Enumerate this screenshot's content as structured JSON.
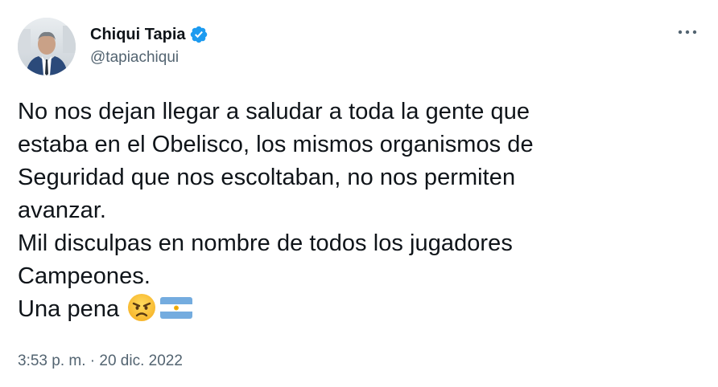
{
  "author": {
    "display_name": "Chiqui Tapia",
    "handle": "@tapiachiqui",
    "verified": true,
    "verified_color": "#1d9bf0"
  },
  "tweet": {
    "lines": [
      "No nos dejan llegar a saludar a toda la gente que",
      "estaba en el Obelisco, los mismos organismos de",
      "Seguridad que nos escoltaban, no nos permiten",
      "avanzar.",
      "Mil disculpas en nombre de todos los jugadores",
      "Campeones.",
      "Una pena"
    ],
    "emojis": [
      "angry-face-icon",
      "argentina-flag-icon"
    ]
  },
  "meta": {
    "time": "3:53 p. m.",
    "separator": "·",
    "date": "20 dic. 2022"
  },
  "colors": {
    "text": "#0f1419",
    "secondary": "#536471",
    "verified": "#1d9bf0"
  }
}
